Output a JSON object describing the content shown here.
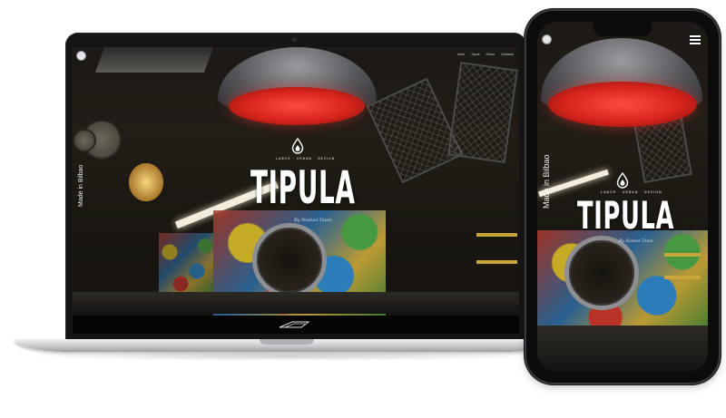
{
  "site": {
    "title": "TIPULA",
    "tagline": "LABOR · URBAN · DESIGN",
    "byline": "By Nodust Team",
    "side_text": "Made in Bilbao",
    "nav_items": [
      "Inicio",
      "Tipula",
      "Obras",
      "Contacto"
    ]
  },
  "icons": {
    "logo": "circle-badge-icon",
    "drop": "water-drop-icon",
    "menu": "hamburger-menu-icon",
    "footer": "wing-logo-icon"
  },
  "colors": {
    "lamp_red": "#d7241c",
    "background": "#ffffff",
    "device_frame": "#151517"
  }
}
